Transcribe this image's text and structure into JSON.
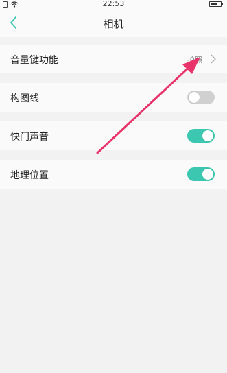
{
  "status_bar": {
    "time": "22:53"
  },
  "header": {
    "title": "相机",
    "back_icon": "chevron-left-icon",
    "accent": "#3cc7b0"
  },
  "settings": [
    {
      "label": "音量键功能",
      "value": "拍照",
      "type": "link"
    },
    {
      "label": "构图线",
      "type": "toggle",
      "enabled": false
    },
    {
      "label": "快门声音",
      "type": "toggle",
      "enabled": true
    },
    {
      "label": "地理位置",
      "type": "toggle",
      "enabled": true
    }
  ],
  "annotation": {
    "color": "#e8336b"
  }
}
